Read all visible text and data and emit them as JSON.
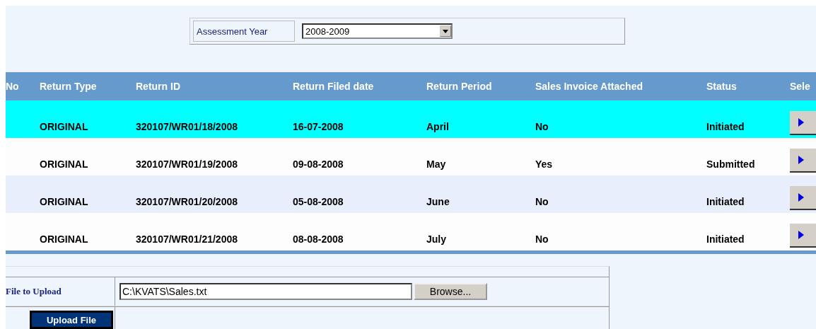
{
  "assessment": {
    "label": "Assessment Year",
    "value": "2008-2009"
  },
  "table": {
    "columns": [
      "No",
      "Return Type",
      "Return ID",
      "Return Filed date",
      "Return Period",
      "Sales Invoice Attached",
      "Status",
      "Sele"
    ],
    "rows": [
      {
        "selected": true,
        "cells": [
          "",
          "ORIGINAL",
          "320107/WR01/18/2008",
          "16-07-2008",
          "April",
          "No",
          "Initiated"
        ]
      },
      {
        "selected": false,
        "cells": [
          "",
          "ORIGINAL",
          "320107/WR01/19/2008",
          "09-08-2008",
          "May",
          "Yes",
          "Submitted"
        ]
      },
      {
        "selected": false,
        "cells": [
          "",
          "ORIGINAL",
          "320107/WR01/20/2008",
          "05-08-2008",
          "June",
          "No",
          "Initiated"
        ]
      },
      {
        "selected": false,
        "cells": [
          "",
          "ORIGINAL",
          "320107/WR01/21/2008",
          "08-08-2008",
          "July",
          "No",
          "Initiated"
        ]
      }
    ]
  },
  "upload": {
    "label": "File to Upload",
    "value": "C:\\KVATS\\Sales.txt",
    "browse": "Browse...",
    "button": "Upload File"
  }
}
